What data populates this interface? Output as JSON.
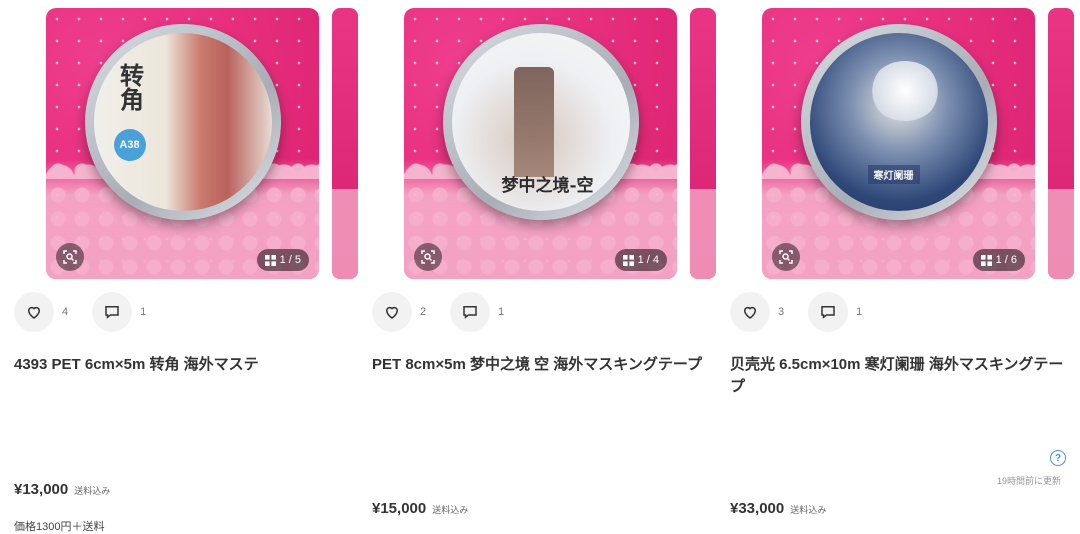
{
  "listings": [
    {
      "image_count": "1 / 5",
      "tape_art": {
        "text": "转角",
        "badge": "A38"
      },
      "likes": "4",
      "comments": "1",
      "title": "4393 PET 6cm×5m 转角 海外マステ",
      "price": "¥13,000",
      "shipping": "送料込み",
      "note": "価格1300円＋送料"
    },
    {
      "image_count": "1 / 4",
      "tape_art": {
        "text": "梦中之境-空"
      },
      "likes": "2",
      "comments": "1",
      "title": "PET 8cm×5m 梦中之境 空 海外マスキングテープ",
      "price": "¥15,000",
      "shipping": "送料込み"
    },
    {
      "image_count": "1 / 6",
      "tape_art": {
        "text": "寒灯阑珊"
      },
      "likes": "3",
      "comments": "1",
      "title": "贝壳光 6.5cm×10m 寒灯阑珊 海外マスキングテープ",
      "price": "¥33,000",
      "shipping": "送料込み"
    }
  ],
  "updated_label": "19時間前に更新",
  "help_symbol": "?",
  "icons": {
    "like": "heart-outline-icon",
    "comment": "speech-bubble-icon",
    "image_search": "lens-search-icon",
    "gallery": "grid-icon",
    "help": "question-circle-icon"
  },
  "colors": {
    "image_background": "#e8307f",
    "price_text": "#333333",
    "help_icon": "#4a90d9"
  }
}
